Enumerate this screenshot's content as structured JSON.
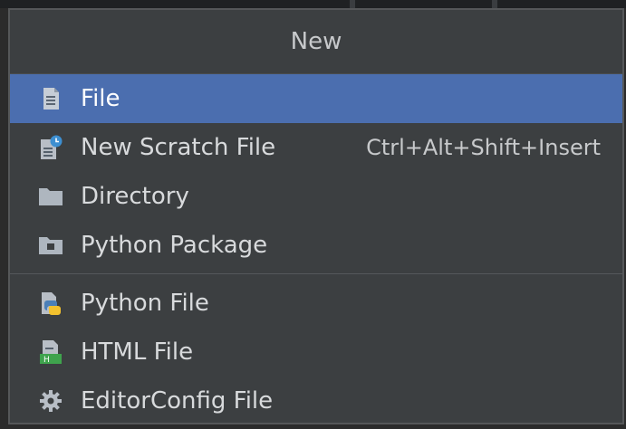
{
  "popup": {
    "title": "New",
    "groups": [
      {
        "items": [
          {
            "label": "File",
            "icon": "file-icon",
            "shortcut": "",
            "selected": true
          },
          {
            "label": "New Scratch File",
            "icon": "scratch-file-icon",
            "shortcut": "Ctrl+Alt+Shift+Insert",
            "selected": false
          },
          {
            "label": "Directory",
            "icon": "folder-icon",
            "shortcut": "",
            "selected": false
          },
          {
            "label": "Python Package",
            "icon": "package-folder-icon",
            "shortcut": "",
            "selected": false
          }
        ]
      },
      {
        "items": [
          {
            "label": "Python File",
            "icon": "python-file-icon",
            "shortcut": "",
            "selected": false
          },
          {
            "label": "HTML File",
            "icon": "html-file-icon",
            "shortcut": "",
            "selected": false
          },
          {
            "label": "EditorConfig File",
            "icon": "gear-icon",
            "shortcut": "",
            "selected": false
          }
        ]
      }
    ]
  },
  "colors": {
    "selection": "#4b6eaf",
    "background": "#3c3f41",
    "text": "#d8dadc"
  }
}
